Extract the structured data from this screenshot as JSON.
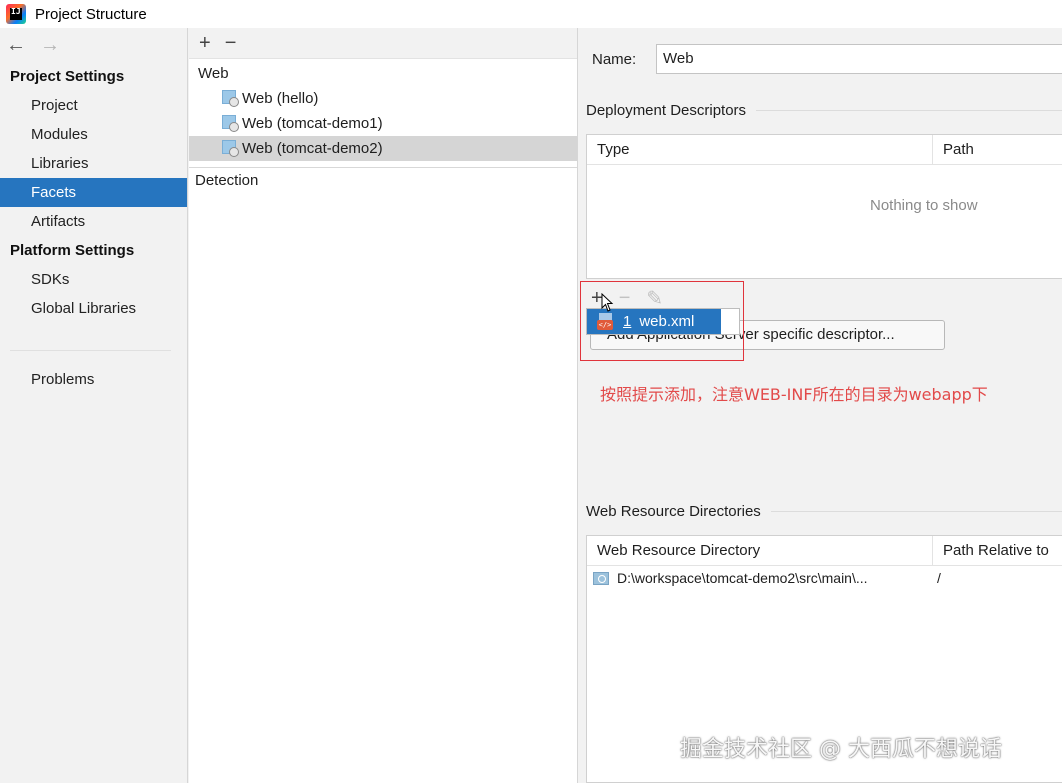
{
  "window": {
    "title": "Project Structure"
  },
  "leftnav": {
    "project_settings_header": "Project Settings",
    "items_project": [
      "Project",
      "Modules",
      "Libraries",
      "Facets",
      "Artifacts"
    ],
    "selected_item": "Facets",
    "platform_settings_header": "Platform Settings",
    "items_platform": [
      "SDKs",
      "Global Libraries"
    ],
    "problems": "Problems"
  },
  "middle": {
    "tree_root": "Web",
    "tree_items": [
      "Web (hello)",
      "Web (tomcat-demo1)",
      "Web (tomcat-demo2)"
    ],
    "selected_index": 2,
    "detection": "Detection"
  },
  "right": {
    "name_label": "Name:",
    "name_value": "Web",
    "deployment_title": "Deployment Descriptors",
    "deployment_columns": [
      "Type",
      "Path"
    ],
    "empty_text": "Nothing to show",
    "add_server_button": "Add Application Server specific descriptor...",
    "popup_item_number": "1",
    "popup_item_label": "web.xml",
    "annotation": "按照提示添加，注意WEB-INF所在的目录为webapp下",
    "web_resource_title": "Web Resource Directories",
    "web_resource_columns": [
      "Web Resource Directory",
      "Path Relative to"
    ],
    "web_resource_rows": [
      {
        "directory": "D:\\workspace\\tomcat-demo2\\src\\main\\...",
        "relative": "/"
      }
    ]
  },
  "watermark": "掘金技术社区 @ 大西瓜不想说话",
  "icons": [
    "back-arrow-icon",
    "forward-arrow-icon",
    "plus-icon",
    "minus-icon",
    "pencil-icon",
    "web-facet-icon",
    "xml-file-icon",
    "folder-icon"
  ]
}
